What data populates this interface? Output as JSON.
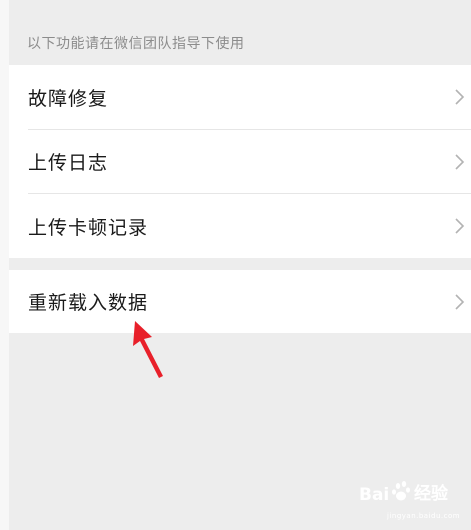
{
  "section_hint": "以下功能请在微信团队指导下使用",
  "items_group_a": [
    {
      "label": "故障修复"
    },
    {
      "label": "上传日志"
    },
    {
      "label": "上传卡顿记录"
    }
  ],
  "items_group_b": [
    {
      "label": "重新载入数据"
    }
  ],
  "watermark": {
    "brand": "Bai",
    "brand_suffix": "经验",
    "url": "jingyan.baidu.com"
  },
  "colors": {
    "background": "#ededed",
    "row_background": "#ffffff",
    "annotation_arrow": "#e8202a"
  }
}
